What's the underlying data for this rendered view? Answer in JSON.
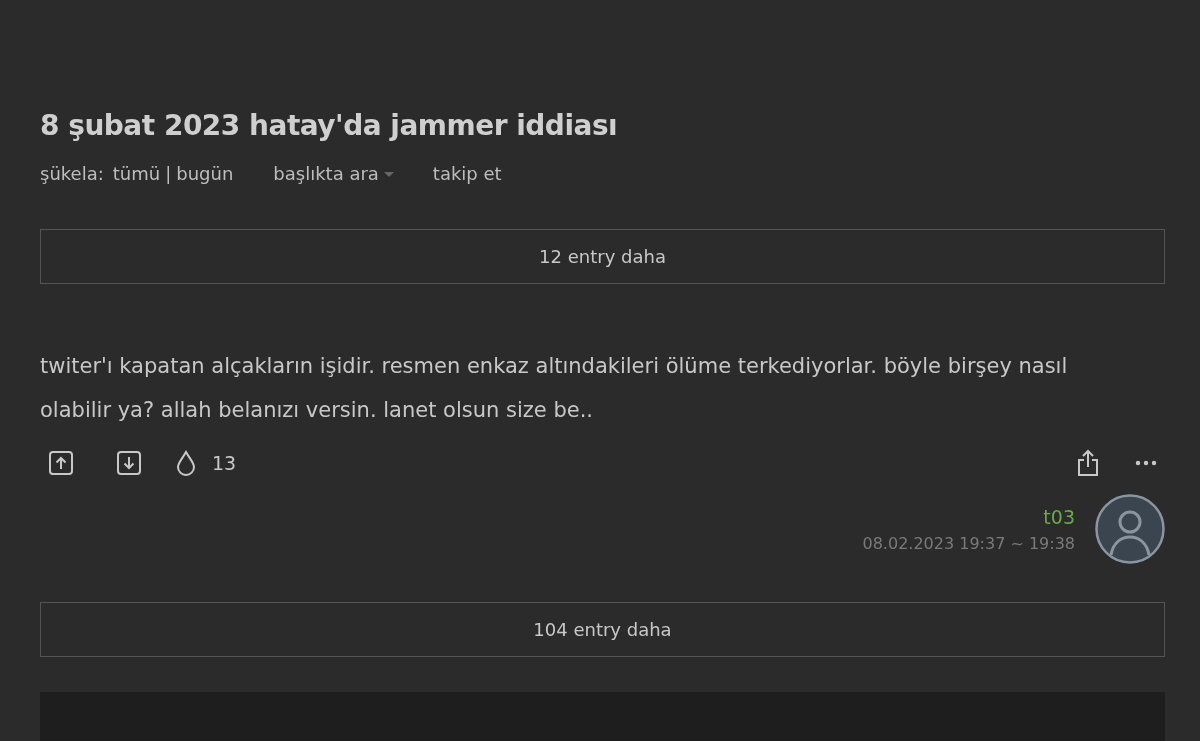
{
  "topic": {
    "title": "8 şubat 2023 hatay'da jammer iddiası"
  },
  "filters": {
    "label": "şükela:",
    "options": [
      {
        "label": "tümü"
      },
      {
        "label": "bugün"
      }
    ],
    "separator": "|",
    "search": "başlıkta ara",
    "follow": "takip et"
  },
  "more_before": "12 entry daha",
  "entry": {
    "text": "twiter'ı kapatan alçakların işidir. resmen enkaz altındakileri ölüme terkediyorlar. böyle birşey nasıl olabilir ya? allah belanızı versin. lanet olsun size be..",
    "favorites": "13",
    "author": "t03",
    "date": "08.02.2023 19:37 ~ 19:38"
  },
  "more_after": "104 entry daha"
}
